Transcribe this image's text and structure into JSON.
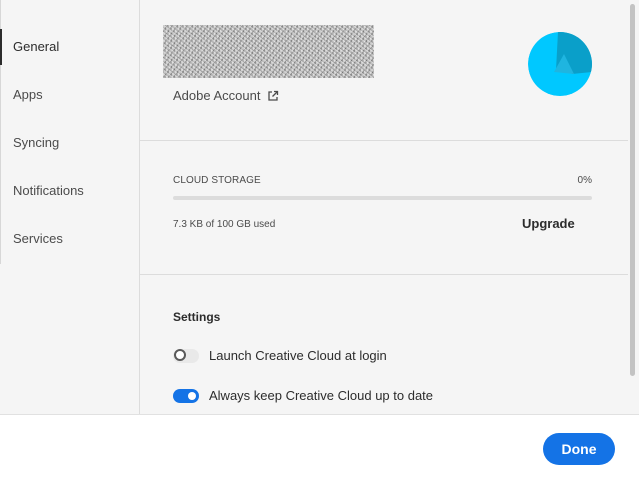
{
  "sidebar": {
    "items": [
      {
        "label": "General",
        "active": true
      },
      {
        "label": "Apps",
        "active": false
      },
      {
        "label": "Syncing",
        "active": false
      },
      {
        "label": "Notifications",
        "active": false
      },
      {
        "label": "Services",
        "active": false
      }
    ]
  },
  "account": {
    "link_label": "Adobe Account",
    "link_icon": "external-link-icon",
    "avatar_colors": [
      "#00c8ff",
      "#0a9fc9",
      "#1fb5e0"
    ]
  },
  "storage": {
    "label": "CLOUD STORAGE",
    "percent_text": "0%",
    "used_fraction": 0,
    "used_text": "7.3 KB of 100 GB used",
    "upgrade_label": "Upgrade"
  },
  "settings": {
    "title": "Settings",
    "options": [
      {
        "label": "Launch Creative Cloud at login",
        "enabled": false
      },
      {
        "label": "Always keep Creative Cloud up to date",
        "enabled": true
      }
    ]
  },
  "footer": {
    "done_label": "Done"
  },
  "colors": {
    "accent": "#1473e6",
    "panel_bg": "#f5f5f5"
  }
}
